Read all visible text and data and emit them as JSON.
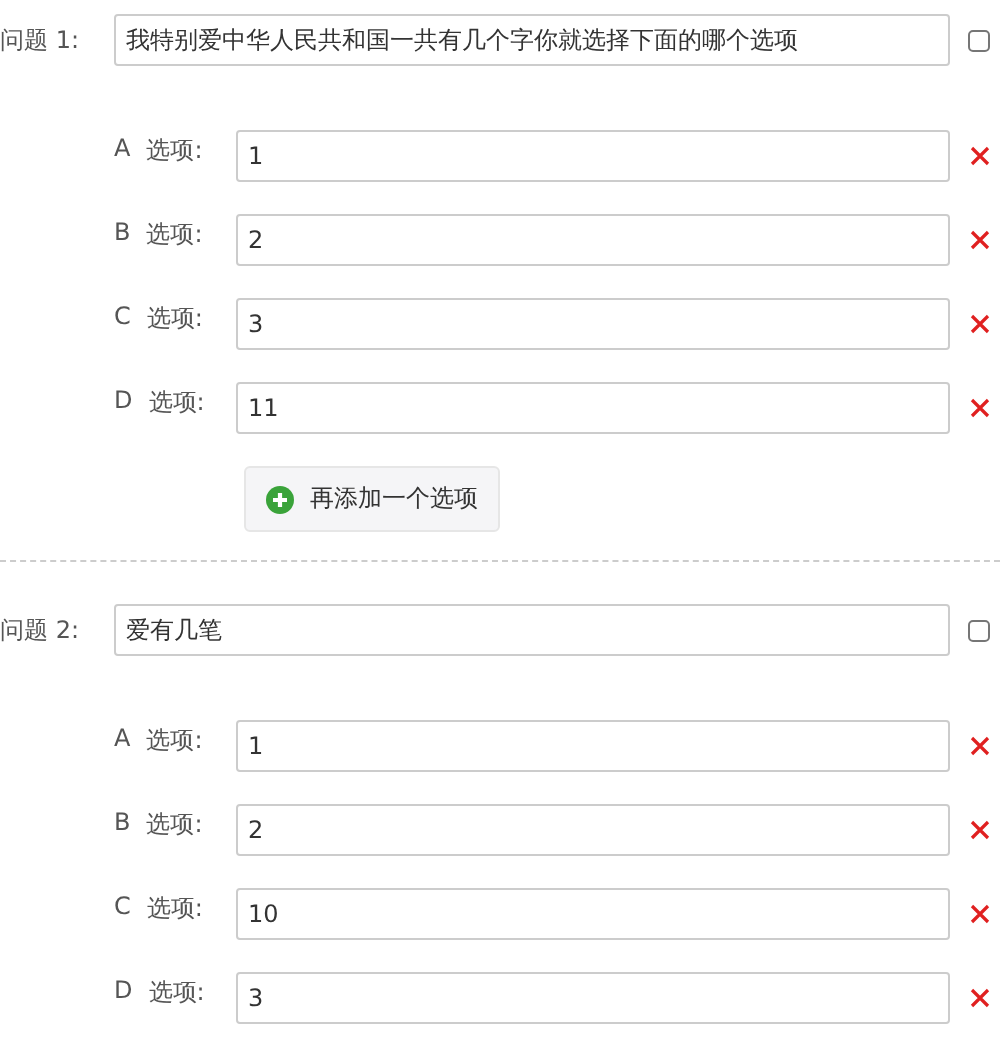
{
  "questions": [
    {
      "label": "问题 1:",
      "text": "我特别爱中华人民共和国一共有几个字你就选择下面的哪个选项",
      "checked": false,
      "options": [
        {
          "letter": "A",
          "label": "选项:",
          "value": "1"
        },
        {
          "letter": "B",
          "label": "选项:",
          "value": "2"
        },
        {
          "letter": "C",
          "label": "选项:",
          "value": "3"
        },
        {
          "letter": "D",
          "label": "选项:",
          "value": "11"
        }
      ],
      "add_button": "再添加一个选项"
    },
    {
      "label": "问题 2:",
      "text": "爱有几笔",
      "checked": false,
      "options": [
        {
          "letter": "A",
          "label": "选项:",
          "value": "1"
        },
        {
          "letter": "B",
          "label": "选项:",
          "value": "2"
        },
        {
          "letter": "C",
          "label": "选项:",
          "value": "10"
        },
        {
          "letter": "D",
          "label": "选项:",
          "value": "3"
        }
      ]
    }
  ]
}
